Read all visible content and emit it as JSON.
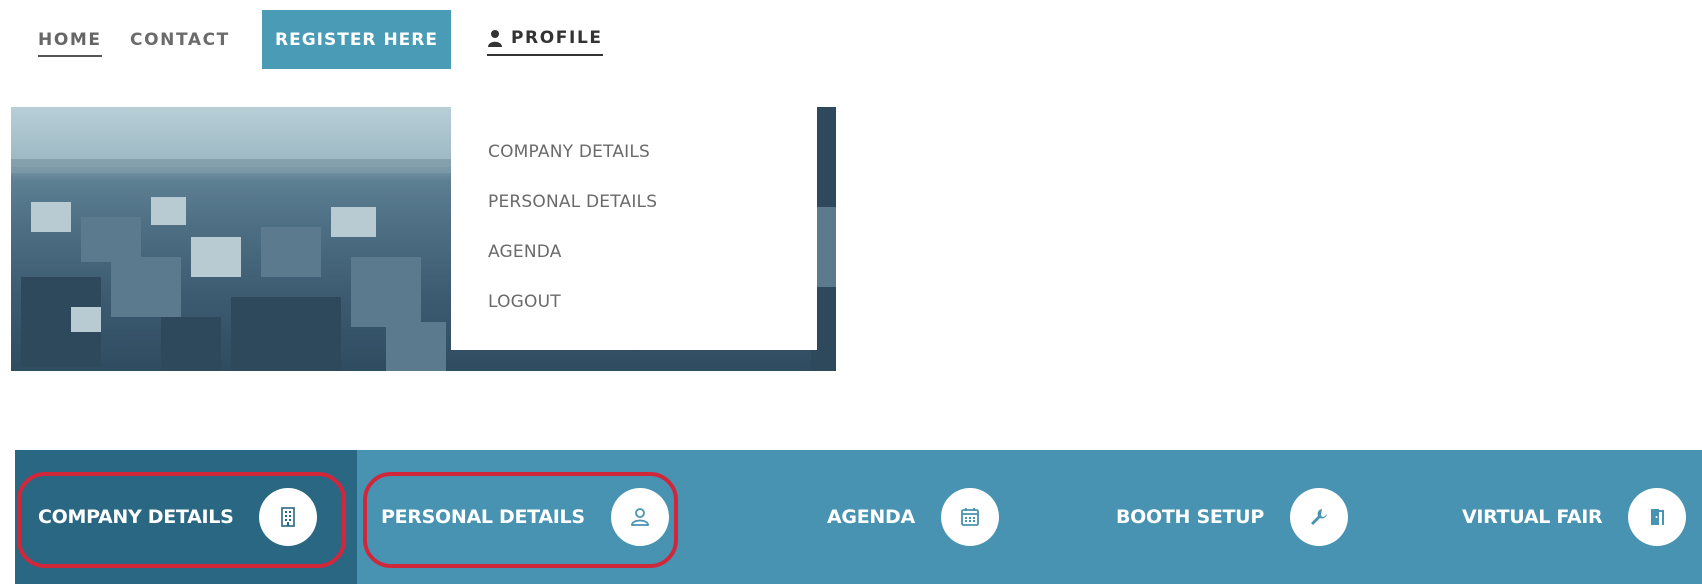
{
  "nav": {
    "home": "HOME",
    "contact": "CONTACT",
    "register": "REGISTER HERE",
    "profile": "PROFILE"
  },
  "dropdown": {
    "items": [
      "COMPANY DETAILS",
      "PERSONAL DETAILS",
      "AGENDA",
      "LOGOUT"
    ]
  },
  "steps": [
    {
      "label": "COMPANY DETAILS",
      "icon": "building-icon",
      "active": true
    },
    {
      "label": "PERSONAL DETAILS",
      "icon": "user-outline-icon"
    },
    {
      "label": "AGENDA",
      "icon": "calendar-icon"
    },
    {
      "label": "BOOTH SETUP",
      "icon": "wrench-icon"
    },
    {
      "label": "VIRTUAL FAIR",
      "icon": "door-exit-icon"
    }
  ],
  "colors": {
    "accent": "#4793b1",
    "active_step": "#2a6783",
    "highlight": "#d0283a"
  }
}
